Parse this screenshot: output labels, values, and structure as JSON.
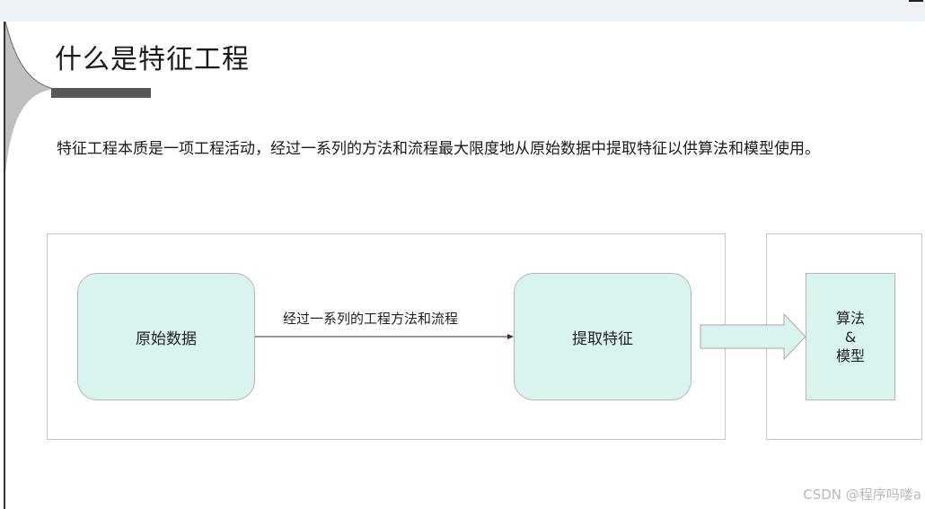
{
  "slide": {
    "title": "什么是特征工程",
    "description": "特征工程本质是一项工程活动，经过一系列的方法和流程最大限度地从原始数据中提取特征以供算法和模型使用。"
  },
  "diagram": {
    "raw_data_label": "原始数据",
    "arrow_label": "经过一系列的工程方法和流程",
    "extracted_features_label": "提取特征",
    "model_label_line1": "算法",
    "model_label_line2": "&",
    "model_label_line3": "模型"
  },
  "colors": {
    "node_fill": "#d9f4ee",
    "node_border": "#b7b7b7",
    "title_bar": "#575757"
  },
  "watermark": "CSDN @程序吗喽a"
}
